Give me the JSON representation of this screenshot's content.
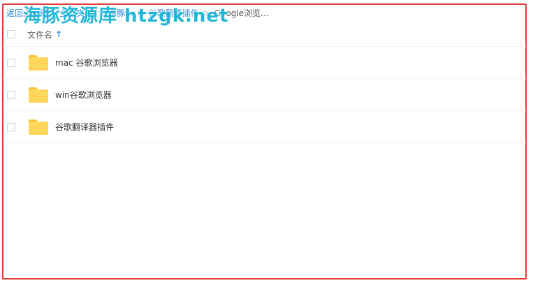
{
  "breadcrumb": {
    "back": "返回上一级",
    "sep": "|",
    "items": [
      "全部文件",
      ">",
      "海豚...",
      ">",
      "谷歌翻译插件",
      ">"
    ],
    "current": "Google浏览..."
  },
  "watermark": "海豚资源库 htzgk.net",
  "table": {
    "header_label": "文件名",
    "rows": [
      {
        "name": "mac 谷歌浏览器"
      },
      {
        "name": "win谷歌浏览器"
      },
      {
        "name": "谷歌翻译器插件"
      }
    ]
  },
  "colors": {
    "accent": "#2f8ce0",
    "frame": "#e53935",
    "folder": "#ffd65c",
    "watermark": "#17b3d8"
  }
}
